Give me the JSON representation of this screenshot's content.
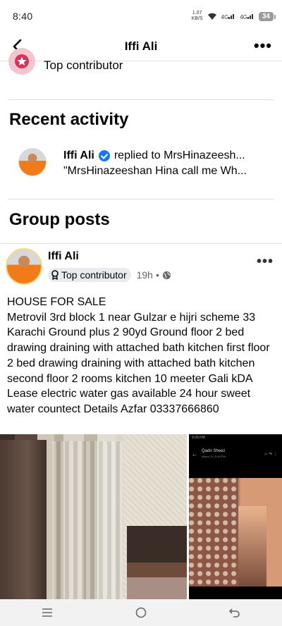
{
  "status_bar": {
    "time": "8:40",
    "speed_value": "1.07",
    "speed_unit": "KB/S",
    "network1": "4G",
    "network2": "4G",
    "battery": "34"
  },
  "header": {
    "title": "Iffi Ali"
  },
  "badge": {
    "label": "Top contributor",
    "color": "#d6335a"
  },
  "recent_activity": {
    "title": "Recent activity",
    "items": [
      {
        "author": "Iffi Ali",
        "action": "replied to MrsHinazeesh...",
        "snippet": "\"MrsHinazeeshan Hina call me Wh..."
      }
    ]
  },
  "group_posts": {
    "title": "Group posts",
    "posts": [
      {
        "author": "Iffi Ali",
        "badge": "Top contributor",
        "time": "19h",
        "separator": "•",
        "text": "HOUSE FOR SALE\nMetrovil 3rd block 1 near Gulzar e hijri scheme 33 Karachi Ground plus 2 90yd Ground floor 2 bed drawing draining with attached bath kitchen first floor 2 bed drawing draining with attached bath kitchen second floor 2 rooms kitchen 10 meeter Gali kDA Lease electric water gas available 24 hour sweet water countect Details Azfar 03337666860",
        "side_photo": {
          "status_time": "9:26 PM",
          "name": "Qadri Sheez",
          "date": "March 24, 8:38 PM"
        }
      }
    ]
  },
  "colors": {
    "verified": "#1877f2",
    "divider": "#dadde1",
    "secondary_text": "#65676b"
  }
}
